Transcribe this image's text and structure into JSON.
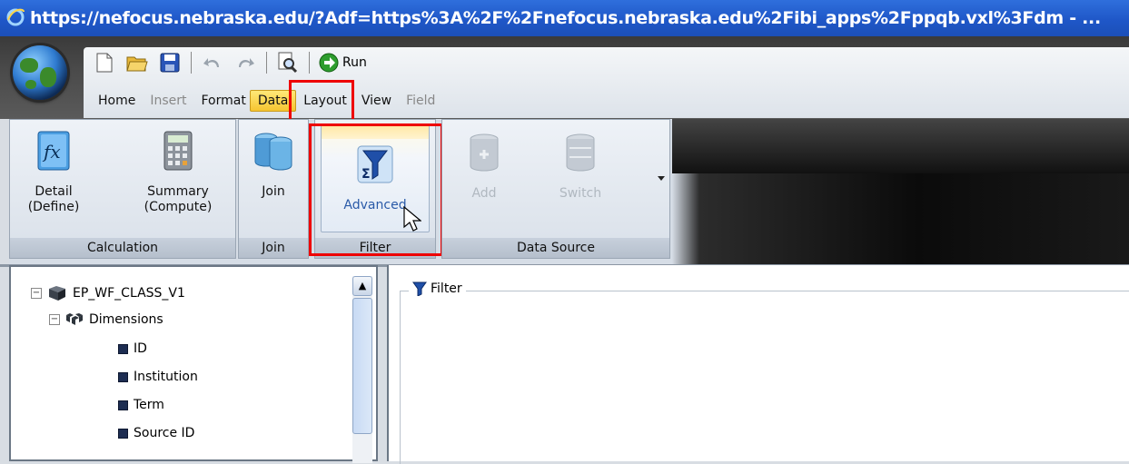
{
  "window": {
    "title": "https://nefocus.nebraska.edu/?Adf=https%3A%2F%2Fnefocus.nebraska.edu%2Fibi_apps%2Fppqb.vxl%3Fdm - ..."
  },
  "quick_access": {
    "run_label": "Run",
    "icons": [
      "new-icon",
      "open-icon",
      "save-icon",
      "undo-icon",
      "redo-icon",
      "preview-icon",
      "run-icon"
    ]
  },
  "tabs": [
    {
      "label": "Home",
      "state": "normal"
    },
    {
      "label": "Insert",
      "state": "disabled"
    },
    {
      "label": "Format",
      "state": "normal"
    },
    {
      "label": "Data",
      "state": "active"
    },
    {
      "label": "Layout",
      "state": "normal"
    },
    {
      "label": "View",
      "state": "normal"
    },
    {
      "label": "Field",
      "state": "disabled"
    }
  ],
  "ribbon": {
    "calculation": {
      "group_label": "Calculation",
      "detail_label_1": "Detail",
      "detail_label_2": "(Define)",
      "summary_label_1": "Summary",
      "summary_label_2": "(Compute)"
    },
    "join": {
      "group_label": "Join",
      "button_label": "Join"
    },
    "filter": {
      "group_label": "Filter",
      "button_label": "Advanced"
    },
    "data_source": {
      "group_label": "Data Source",
      "add_label": "Add",
      "switch_label": "Switch"
    }
  },
  "tree": {
    "root": "EP_WF_CLASS_V1",
    "dimensions_label": "Dimensions",
    "fields": [
      "ID",
      "Institution",
      "Term",
      "Source ID"
    ]
  },
  "filter_panel": {
    "legend": "Filter"
  },
  "colors": {
    "highlight_border": "#e00000",
    "active_tab": "#f6c531",
    "titlebar": "#1f57c8"
  }
}
